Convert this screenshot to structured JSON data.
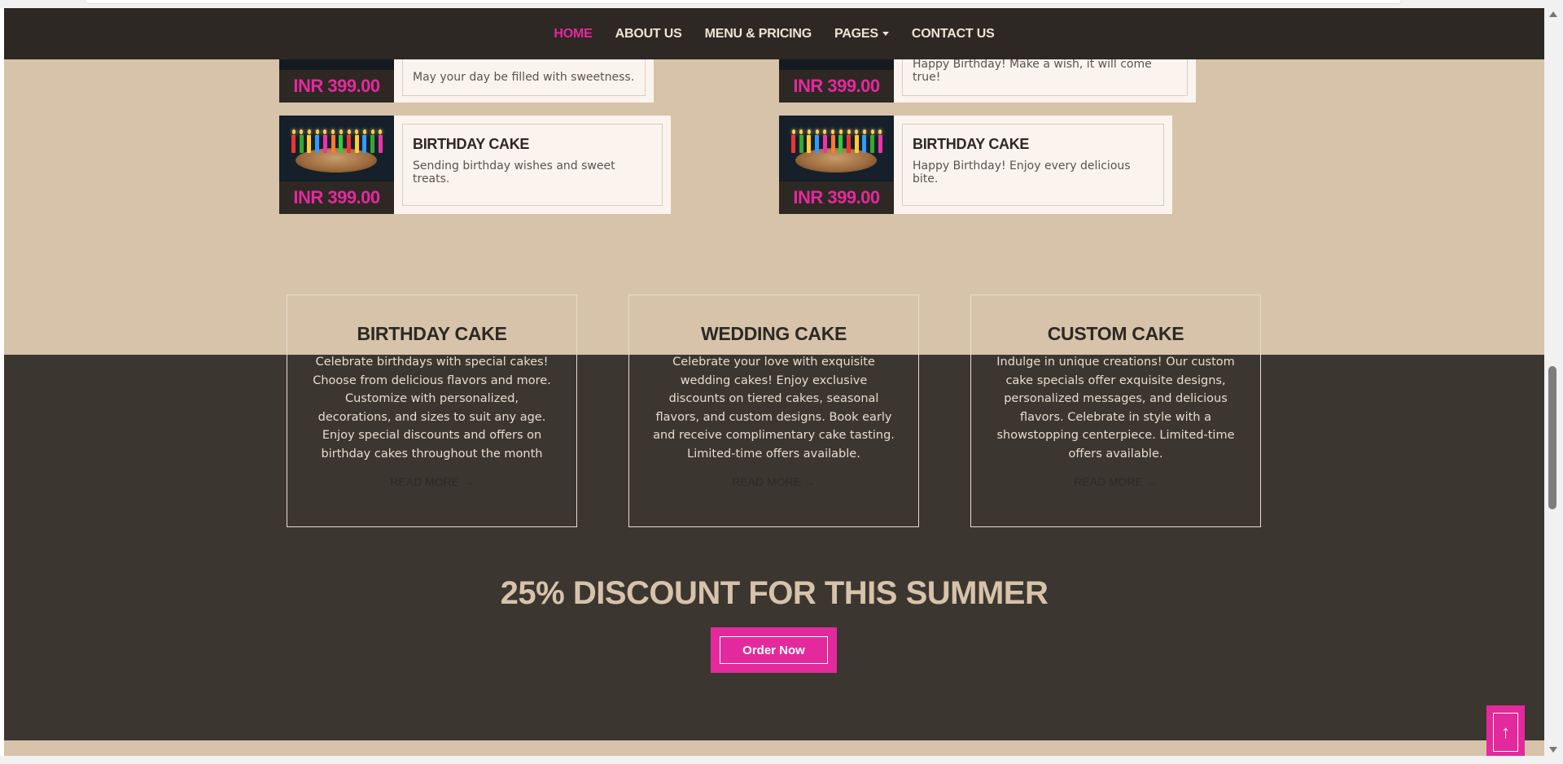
{
  "nav": {
    "items": [
      {
        "label": "HOME",
        "active": true
      },
      {
        "label": "ABOUT US"
      },
      {
        "label": "MENU & PRICING"
      },
      {
        "label": "PAGES",
        "dropdown": true
      },
      {
        "label": "CONTACT US"
      }
    ]
  },
  "menu_items": [
    {
      "price": "INR 399.00",
      "title": "",
      "desc": "May your day be filled with sweetness."
    },
    {
      "price": "INR 399.00",
      "title": "",
      "desc": "Happy Birthday! Make a wish, it will come true!"
    },
    {
      "price": "INR 399.00",
      "title": "BIRTHDAY CAKE",
      "desc": "Sending birthday wishes and sweet treats."
    },
    {
      "price": "INR 399.00",
      "title": "BIRTHDAY CAKE",
      "desc": "Happy Birthday! Enjoy every delicious bite."
    }
  ],
  "services": [
    {
      "title": "BIRTHDAY CAKE",
      "desc": "Celebrate birthdays with special cakes! Choose from delicious flavors and more. Customize with personalized, decorations, and sizes to suit any age. Enjoy special discounts and offers on birthday cakes throughout the month",
      "link": "READ MORE →"
    },
    {
      "title": "WEDDING CAKE",
      "desc": "Celebrate your love with exquisite wedding cakes! Enjoy exclusive discounts on tiered cakes, seasonal flavors, and custom designs. Book early and receive complimentary cake tasting. Limited-time offers available.",
      "link": "READ MORE →"
    },
    {
      "title": "CUSTOM CAKE",
      "desc": "Indulge in unique creations! Our custom cake specials offer exquisite designs, personalized messages, and delicious flavors. Celebrate in style with a showstopping centerpiece. Limited-time offers available.",
      "link": "READ MORE →"
    }
  ],
  "discount": {
    "title": "25% DISCOUNT FOR THIS SUMMER",
    "button": "Order Now"
  },
  "back_to_top": {
    "icon": "arrow-up-icon",
    "glyph": "↑"
  },
  "colors": {
    "accent": "#e4299c",
    "beige": "#d6c3aa",
    "dark": "#3c3631",
    "navbar": "#2d2824"
  }
}
